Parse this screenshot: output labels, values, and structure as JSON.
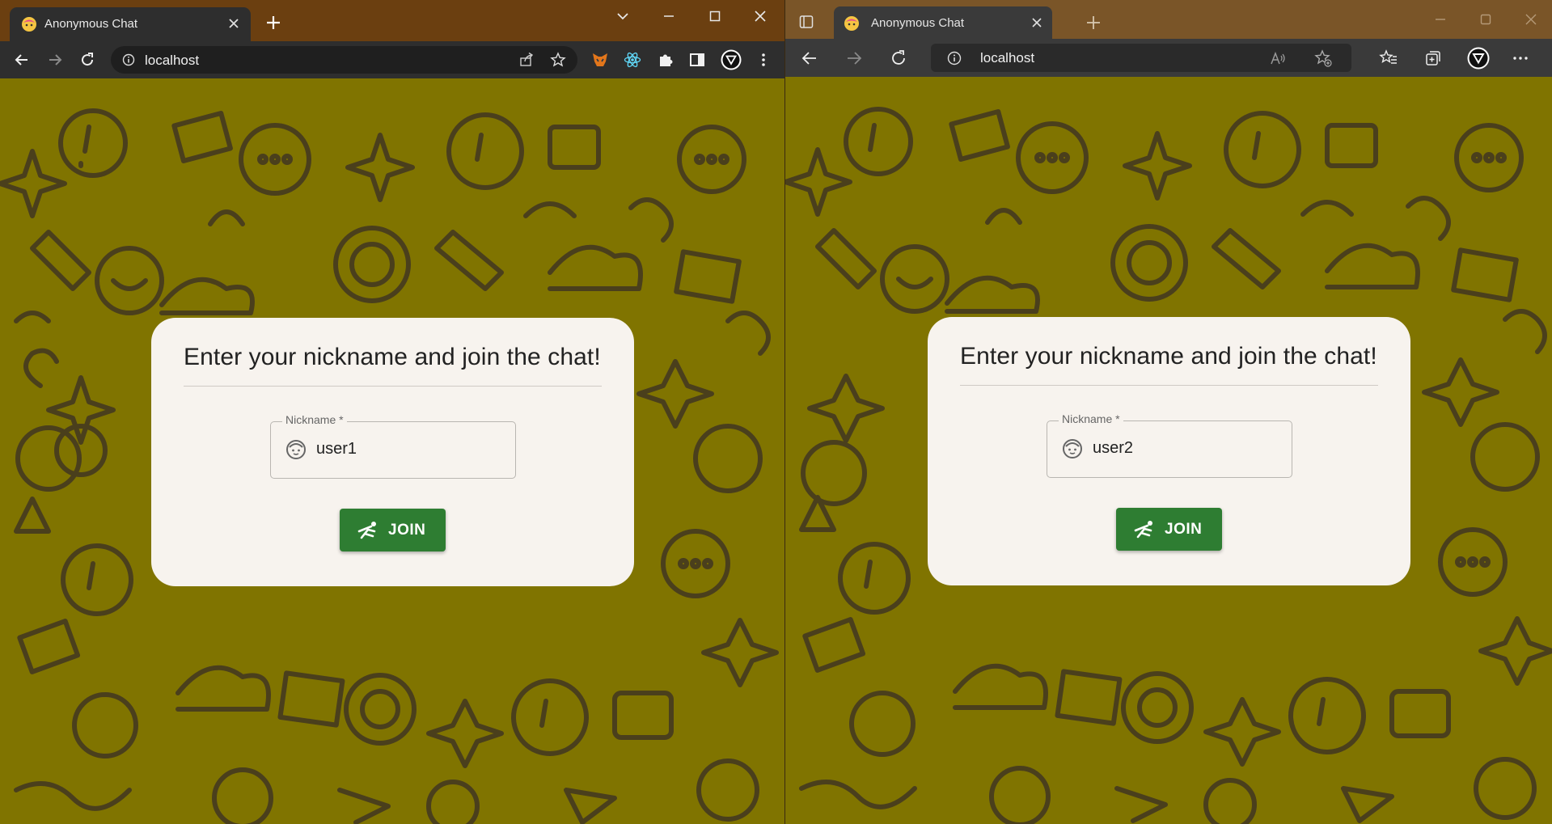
{
  "left_window": {
    "tab_title": "Anonymous Chat",
    "address": "localhost",
    "page": {
      "heading": "Enter your nickname and join the chat!",
      "nickname_label": "Nickname *",
      "nickname_value": "user1",
      "join_label": "JOIN"
    }
  },
  "right_window": {
    "tab_title": "Anonymous Chat",
    "address": "localhost",
    "page": {
      "heading": "Enter your nickname and join the chat!",
      "nickname_label": "Nickname *",
      "nickname_value": "user2",
      "join_label": "JOIN"
    }
  },
  "theme": {
    "background_color": "#807400",
    "doodle_color": "#4a3f1c",
    "card_color": "#f7f3ee",
    "button_color": "#2e7d32"
  },
  "icons": {
    "favicon": "anonymous-chat-favicon",
    "nickname_field": "child-face-icon",
    "join_button": "diving-icon"
  }
}
